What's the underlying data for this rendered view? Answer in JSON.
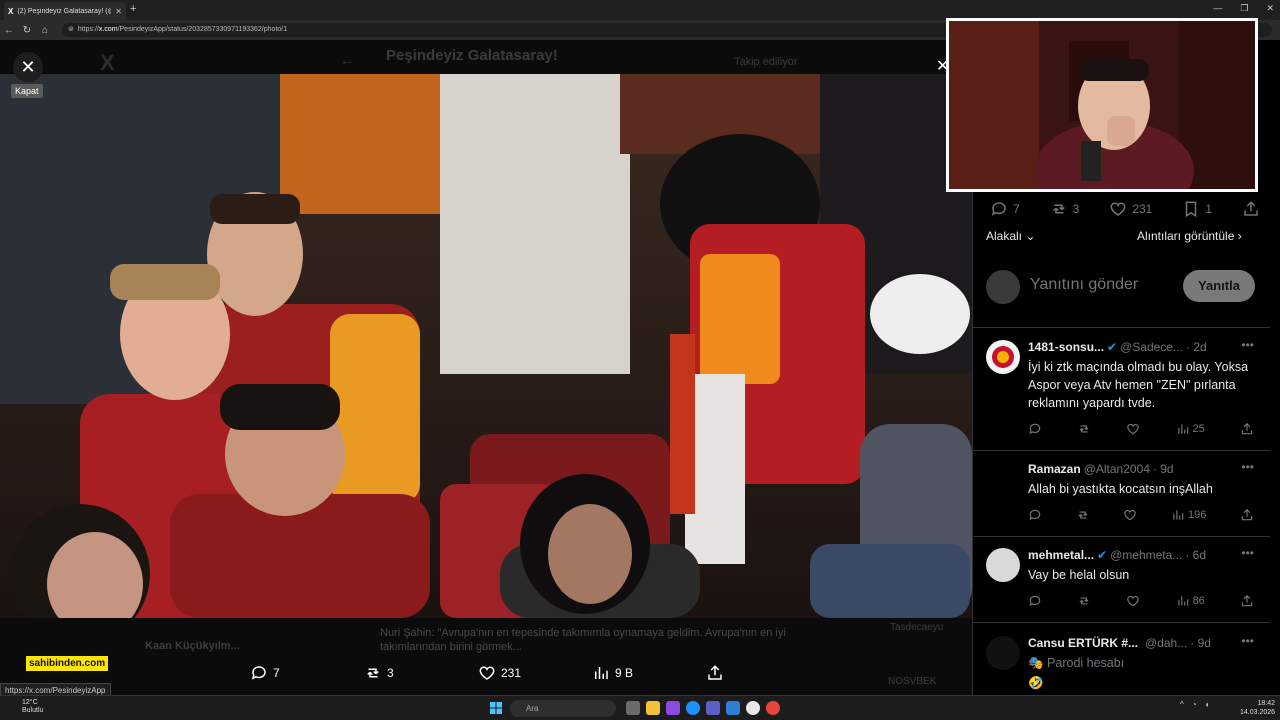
{
  "browser": {
    "tab_title": "(2) Peşindeyiz Galatasaray! (@Peş",
    "url_prefix": "https://",
    "url_host": "x.com",
    "url_path": "/PesindeyizApp/status/2032857330971193362/photo/1",
    "status_url": "https://x.com/PesindeyizApp"
  },
  "underlay": {
    "account_title": "Peşindeyiz Galatasaray!",
    "follow_label": "Takip ediliyor",
    "caption": "Nuri Şahin: \"Avrupa'nın en tepesinde takımımla oynamaya geldim. Avrupa'nın en iyi takımlarından birini görmek...",
    "caption_name": "Kaan Küçükyılm...",
    "right_tag_1": "Tasdecaeyu",
    "right_tag_2": "NOSVBEK"
  },
  "viewer": {
    "close_tooltip": "Kapat",
    "ad_badge": "sahibinden.com",
    "actions": {
      "replies": "7",
      "reposts": "3",
      "likes": "231",
      "views": "9 B"
    }
  },
  "panel": {
    "stats": {
      "replies": "7",
      "reposts": "3",
      "likes": "231",
      "bookmarks": "1"
    },
    "sort_label": "Alakalı",
    "quotes_label": "Alıntıları görüntüle",
    "reply_placeholder": "Yanıtını gönder",
    "reply_button": "Yanıtla",
    "tweets": [
      {
        "name": "1481-sonsu...",
        "handle": "@Sadece...",
        "time": "· 2d",
        "verified": true,
        "text": "İyi ki ztk maçında olmadı bu olay. Yoksa Aspor veya Atv hemen \"ZEN\" pırlanta reklamını yapardı tvde.",
        "views": "25"
      },
      {
        "name": "Ramazan",
        "handle": "@Altan2004",
        "time": "· 9d",
        "verified": false,
        "text": "Allah bi yastıkta kocatsın inşAllah",
        "views": "196"
      },
      {
        "name": "mehmetal...",
        "handle": "@mehmeta...",
        "time": "· 6d",
        "verified": true,
        "text": "Vay be helal olsun",
        "views": "86"
      },
      {
        "name": "Cansu ERTÜRK #...",
        "handle": "@dah...",
        "time": "· 9d",
        "verified": false,
        "text": "Parodi hesabı",
        "emoji": "🤣"
      }
    ]
  },
  "taskbar": {
    "temp": "12°C",
    "weather": "Bulutlu",
    "search_placeholder": "Ara",
    "time": "18:42",
    "date": "14.03.2026"
  }
}
